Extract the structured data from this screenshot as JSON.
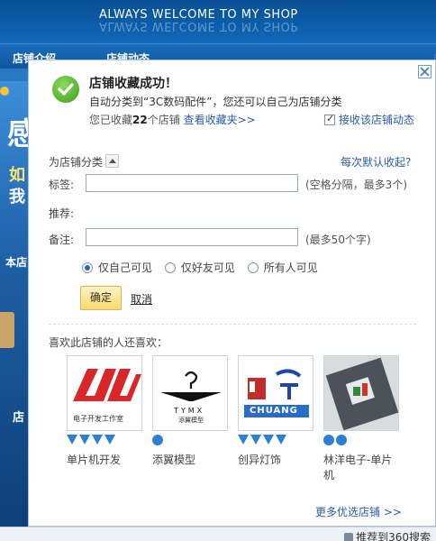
{
  "background": {
    "slogan": "ALWAYS WELCOME TO MY SHOP",
    "nav_items": [
      "店铺介绍",
      "店铺动态"
    ],
    "left_banner_big": "感",
    "left_banner_line1": "如",
    "left_banner_line2": "我",
    "left_tag1": "本店",
    "left_tag2": "店",
    "bottom_link": "推荐到360搜索"
  },
  "dialog": {
    "title": "店铺收藏成功！",
    "desc_prefix": "自动分类到“",
    "desc_category": "3C数码配件",
    "desc_suffix": "”，您还可以自己为店铺分类",
    "collected_prefix": "您已收藏",
    "collected_count": "22",
    "collected_suffix": "个店铺",
    "view_favorites": "查看收藏夹>>",
    "follow_label": "接收该店铺动态",
    "follow_checked": true,
    "category_section": "为店铺分类",
    "default_collapse": "每次默认收起?",
    "tag_label": "标签:",
    "tag_value": "",
    "tag_hint": "(空格分隔，最多3个)",
    "recommend_label": "推荐:",
    "note_label": "备注:",
    "note_value": "",
    "note_hint": "(最多50个字)",
    "visibility": [
      {
        "label": "仅自己可见",
        "selected": true
      },
      {
        "label": "仅好友可见",
        "selected": false
      },
      {
        "label": "所有人可见",
        "selected": false
      }
    ],
    "confirm": "确定",
    "cancel": "取消",
    "recommend_title": "喜欢此店铺的人还喜欢：",
    "shops": [
      {
        "name": "单片机开发",
        "gem_count": 4,
        "logo_caption": "电子开发工作室"
      },
      {
        "name": "添翼模型",
        "gem_count": 1,
        "logo_caption": "添翼模型",
        "logo_text": "TYMX"
      },
      {
        "name": "创异灯饰",
        "gem_count": 4,
        "logo_text": "CHUANG"
      },
      {
        "name": "林洋电子-单片机",
        "gem_count": 2
      }
    ],
    "more_shops": "更多优选店铺 >>"
  },
  "colors": {
    "link": "#2a5aa6",
    "header_blue": "#0b5eab",
    "confirm_bg": "#f9d86e",
    "success_green": "#3a9c1c",
    "gem_blue": "#2f7ed6"
  }
}
